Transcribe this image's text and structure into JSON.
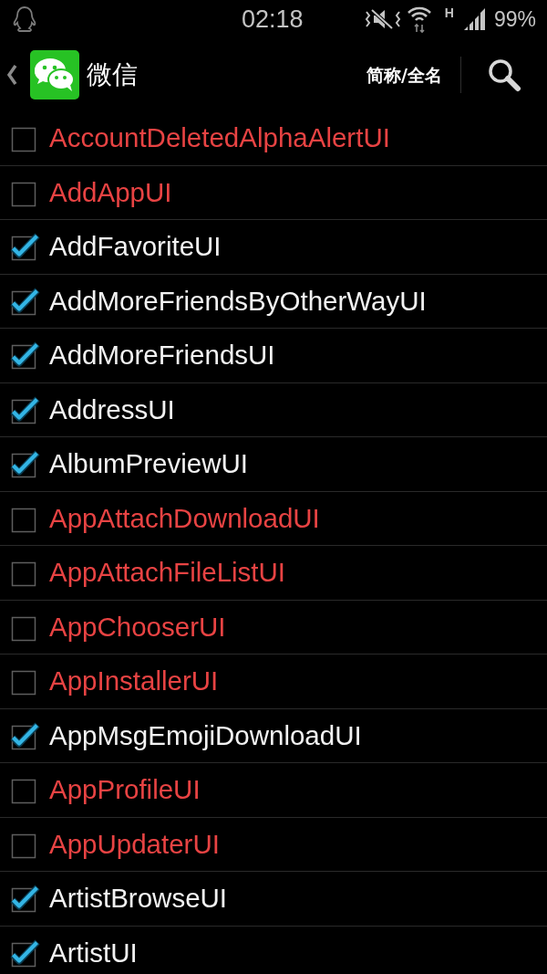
{
  "status_bar": {
    "time": "02:18",
    "network": "H",
    "battery": "99%"
  },
  "action_bar": {
    "title": "微信",
    "name_toggle": "简称/全名"
  },
  "items": [
    {
      "label": "AccountDeletedAlphaAlertUI",
      "checked": false
    },
    {
      "label": "AddAppUI",
      "checked": false
    },
    {
      "label": "AddFavoriteUI",
      "checked": true
    },
    {
      "label": "AddMoreFriendsByOtherWayUI",
      "checked": true
    },
    {
      "label": "AddMoreFriendsUI",
      "checked": true
    },
    {
      "label": "AddressUI",
      "checked": true
    },
    {
      "label": "AlbumPreviewUI",
      "checked": true
    },
    {
      "label": "AppAttachDownloadUI",
      "checked": false
    },
    {
      "label": "AppAttachFileListUI",
      "checked": false
    },
    {
      "label": "AppChooserUI",
      "checked": false
    },
    {
      "label": "AppInstallerUI",
      "checked": false
    },
    {
      "label": "AppMsgEmojiDownloadUI",
      "checked": true
    },
    {
      "label": "AppProfileUI",
      "checked": false
    },
    {
      "label": "AppUpdaterUI",
      "checked": false
    },
    {
      "label": "ArtistBrowseUI",
      "checked": true
    },
    {
      "label": "ArtistUI",
      "checked": true
    }
  ]
}
